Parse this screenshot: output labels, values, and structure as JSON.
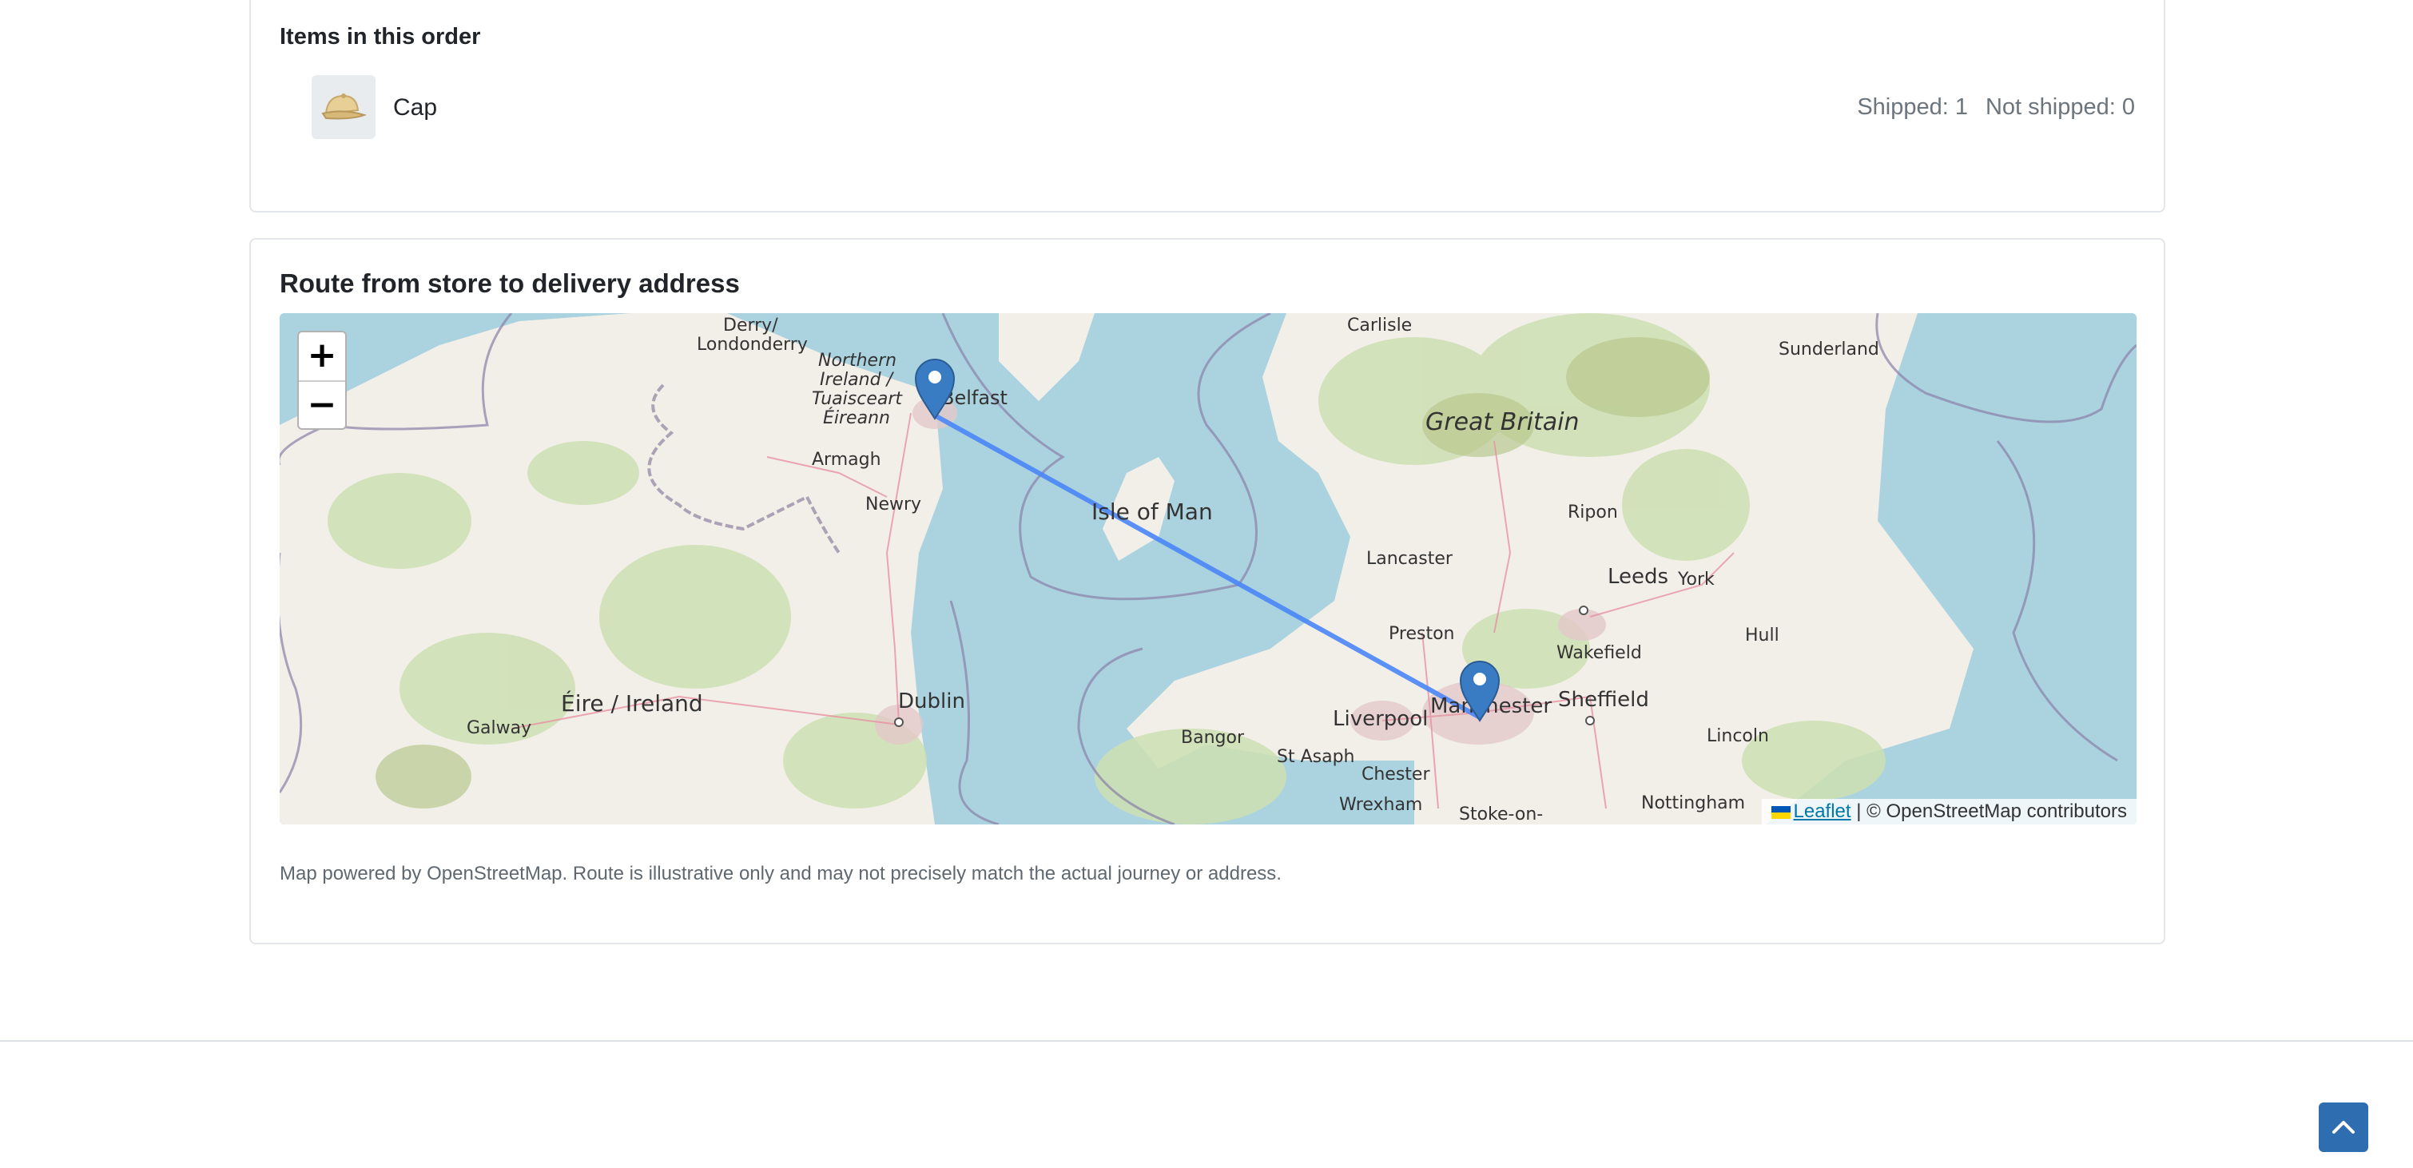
{
  "items_section": {
    "title": "Items in this order",
    "items": [
      {
        "name": "Cap",
        "icon": "cap-icon",
        "shipped": "Shipped: 1",
        "not_shipped": "Not shipped: 0"
      }
    ]
  },
  "map_section": {
    "title": "Route from store to delivery address",
    "zoom_in": "+",
    "zoom_out": "−",
    "attribution_link": "Leaflet",
    "attribution_separator": "|",
    "attribution_text": "© OpenStreetMap contributors",
    "note": "Map powered by OpenStreetMap. Route is illustrative only and may not precisely match the actual journey or address.",
    "labels": {
      "derry": "Derry/",
      "londonderry": "Londonderry",
      "ni1": "Northern",
      "ni2": "Ireland /",
      "ni3": "Tuaisceart",
      "ni4": "Éireann",
      "belfast": "Belfast",
      "armagh": "Armagh",
      "newry": "Newry",
      "isle_of_man": "Isle of Man",
      "eire": "Éire / Ireland",
      "dublin": "Dublin",
      "galway": "Galway",
      "carlisle": "Carlisle",
      "sunderland": "Sunderland",
      "great_britain": "Great Britain",
      "ripon": "Ripon",
      "lancaster": "Lancaster",
      "leeds": "Leeds",
      "york": "York",
      "preston": "Preston",
      "wakefield": "Wakefield",
      "hull": "Hull",
      "liverpool": "Liverpool",
      "manchester": "Manchester",
      "sheffield": "Sheffield",
      "bangor": "Bangor",
      "st_asaph": "St Asaph",
      "chester": "Chester",
      "lincoln": "Lincoln",
      "wrexham": "Wrexham",
      "nottingham": "Nottingham",
      "stoke": "Stoke-on-"
    },
    "colors": {
      "route": "#4a86f7",
      "marker": "#3a7cc4",
      "sea": "#aad3df",
      "land": "#f2efe9"
    }
  },
  "back_to_top": {
    "icon": "chevron-up-icon"
  }
}
